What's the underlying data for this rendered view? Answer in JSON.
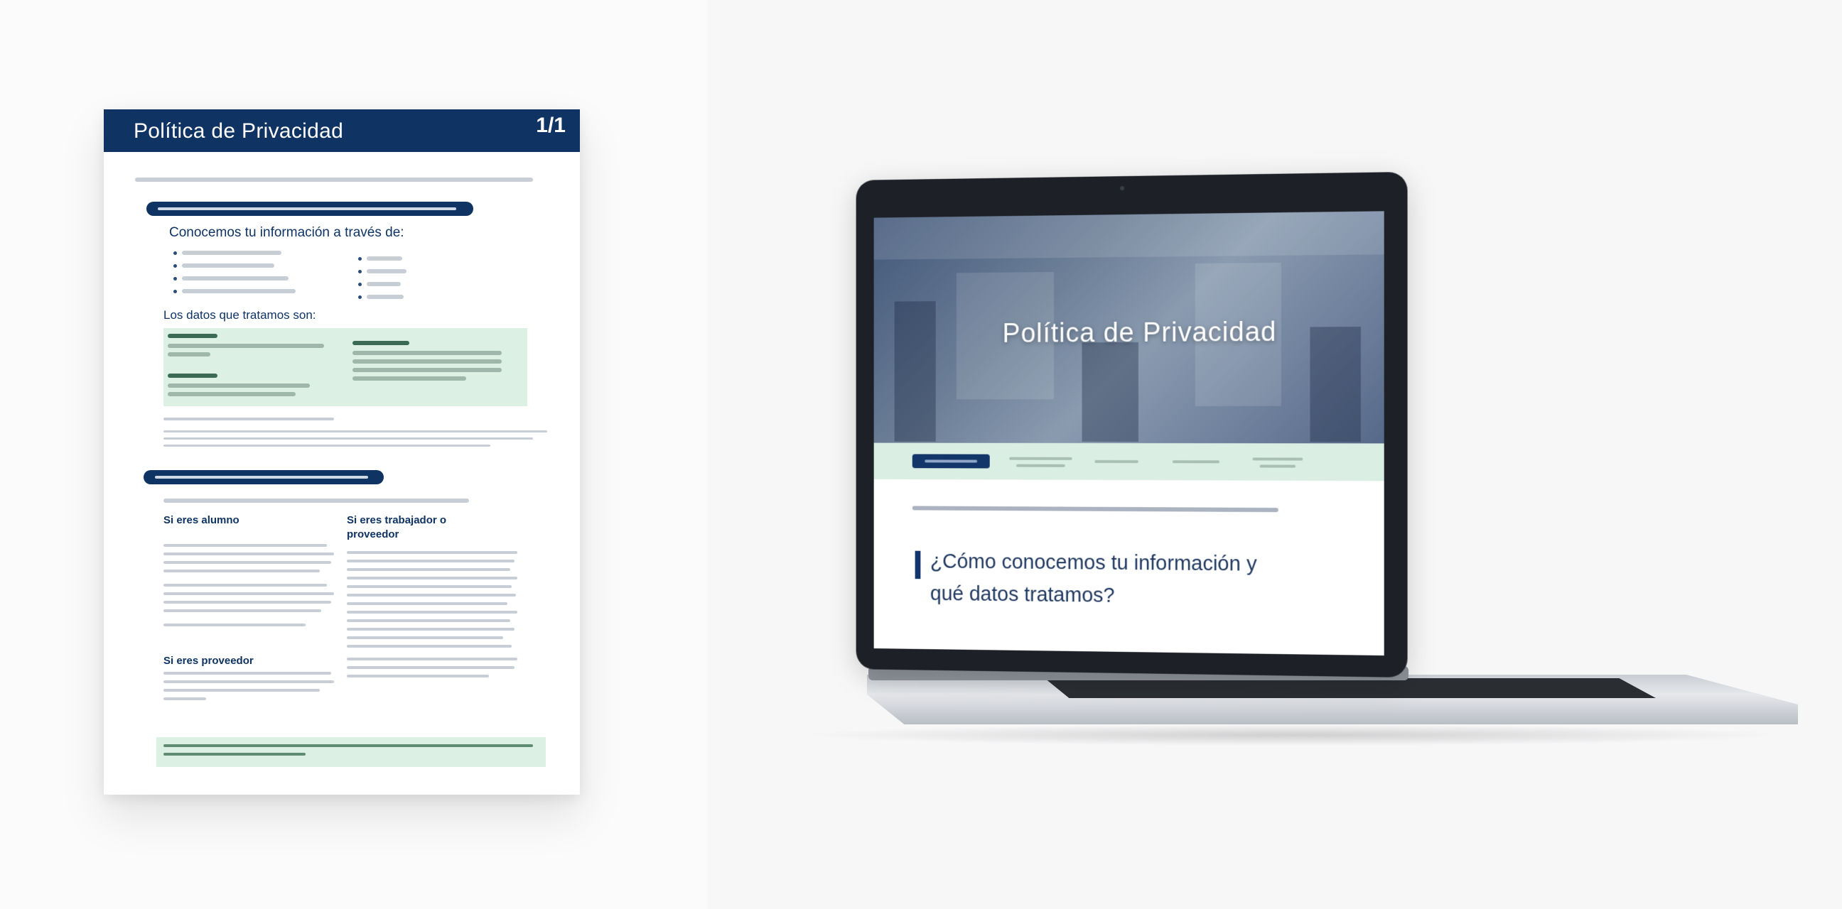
{
  "document": {
    "title": "Política de Privacidad",
    "page_number": "1/1"
  },
  "laptop": {
    "hero_title": "Política de Privacidad",
    "section_title": "¿Cómo conocemos tu información y qué datos tratamos?"
  },
  "colors": {
    "primary_navy": "#0f3463",
    "mint_green": "#dbeee3",
    "page_background": "#fbfbfb"
  }
}
